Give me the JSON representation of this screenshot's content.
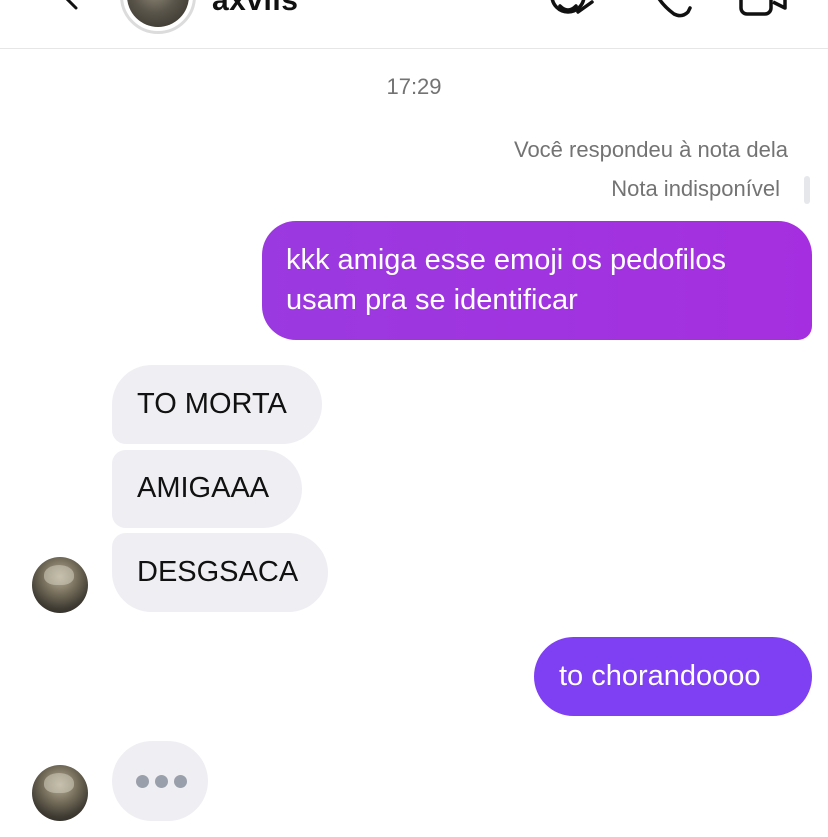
{
  "header": {
    "contact_name": "axvlis"
  },
  "conversation": {
    "timestamp": "17:29",
    "reply_context": "Você respondeu à nota dela",
    "note_status": "Nota indisponível",
    "messages": [
      {
        "direction": "outgoing",
        "text": "kkk amiga esse emoji os pedofilos usam pra se identificar"
      },
      {
        "direction": "incoming",
        "text": "TO MORTA"
      },
      {
        "direction": "incoming",
        "text": "AMIGAAA"
      },
      {
        "direction": "incoming",
        "text": "DESGSACA"
      },
      {
        "direction": "outgoing",
        "text": "to chorandoooo"
      }
    ],
    "typing": true
  },
  "colors": {
    "outgoing_purple": "#a335e0",
    "outgoing_violet": "#7f3ff2",
    "incoming_bubble": "#efeff3"
  },
  "icons": [
    "back-icon",
    "sticker-icon",
    "phone-icon",
    "video-icon"
  ]
}
